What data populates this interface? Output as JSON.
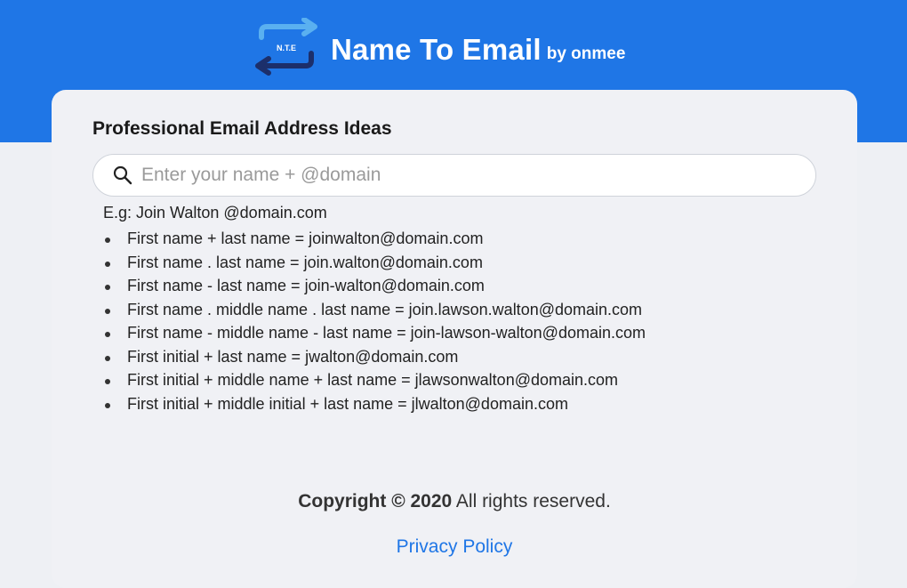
{
  "header": {
    "logo_text": "N.T.E",
    "title": "Name To Email",
    "byline": "by onmee",
    "brand_color": "#1f76e6"
  },
  "card": {
    "title": "Professional Email Address Ideas",
    "search": {
      "placeholder": "Enter your name + @domain",
      "value": "",
      "icon": "search-icon"
    },
    "example": "E.g: Join Walton @domain.com",
    "ideas": [
      "First name + last name = joinwalton@domain.com",
      "First name . last name = join.walton@domain.com",
      "First name - last name = join-walton@domain.com",
      "First name . middle name . last name = join.lawson.walton@domain.com",
      "First name - middle name - last name = join-lawson-walton@domain.com",
      "First initial + last name = jwalton@domain.com",
      "First initial + middle name + last name = jlawsonwalton@domain.com",
      "First initial + middle initial + last name = jlwalton@domain.com"
    ]
  },
  "footer": {
    "copyright_bold": "Copyright © 2020",
    "copyright_rest": " All rights reserved.",
    "privacy_link": "Privacy Policy"
  }
}
